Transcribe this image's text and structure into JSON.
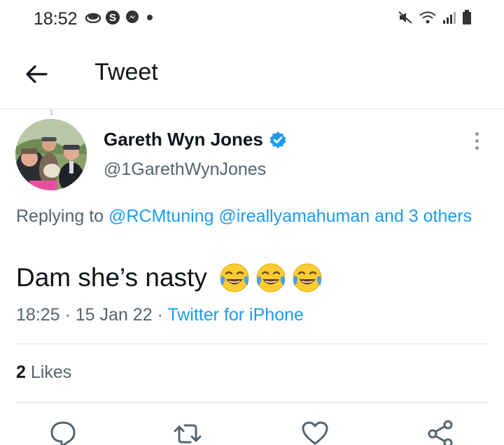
{
  "status_bar": {
    "time": "18:52",
    "left_icons": [
      "cloud-icon",
      "cloud-icon",
      "skype-icon",
      "messenger-icon",
      "dot-icon"
    ],
    "right_icons": [
      "mute-icon",
      "wifi-icon",
      "signal-icon",
      "battery-icon"
    ]
  },
  "header": {
    "back_icon": "arrow-left-icon",
    "title": "Tweet"
  },
  "tweet": {
    "author_name": "Gareth Wyn Jones",
    "author_handle": "@1GarethWynJones",
    "verified": true,
    "reply_prefix": "Replying to ",
    "reply_user1": "@RCMtuning",
    "reply_user2": "@ireallyamahuman",
    "reply_others": "and 3 others",
    "text": "Dam she’s nasty",
    "emojis": [
      "face-with-tears-of-joy",
      "face-with-tears-of-joy",
      "face-with-tears-of-joy"
    ],
    "time": "18:25",
    "date": "15 Jan 22",
    "source": "Twitter for iPhone",
    "like_count": "2",
    "likes_label": "Likes"
  },
  "actions": [
    "reply-icon",
    "retweet-icon",
    "like-icon",
    "share-icon"
  ],
  "colors": {
    "accent": "#1d9bf0",
    "text_primary": "#0f1419",
    "text_secondary": "#536471"
  }
}
